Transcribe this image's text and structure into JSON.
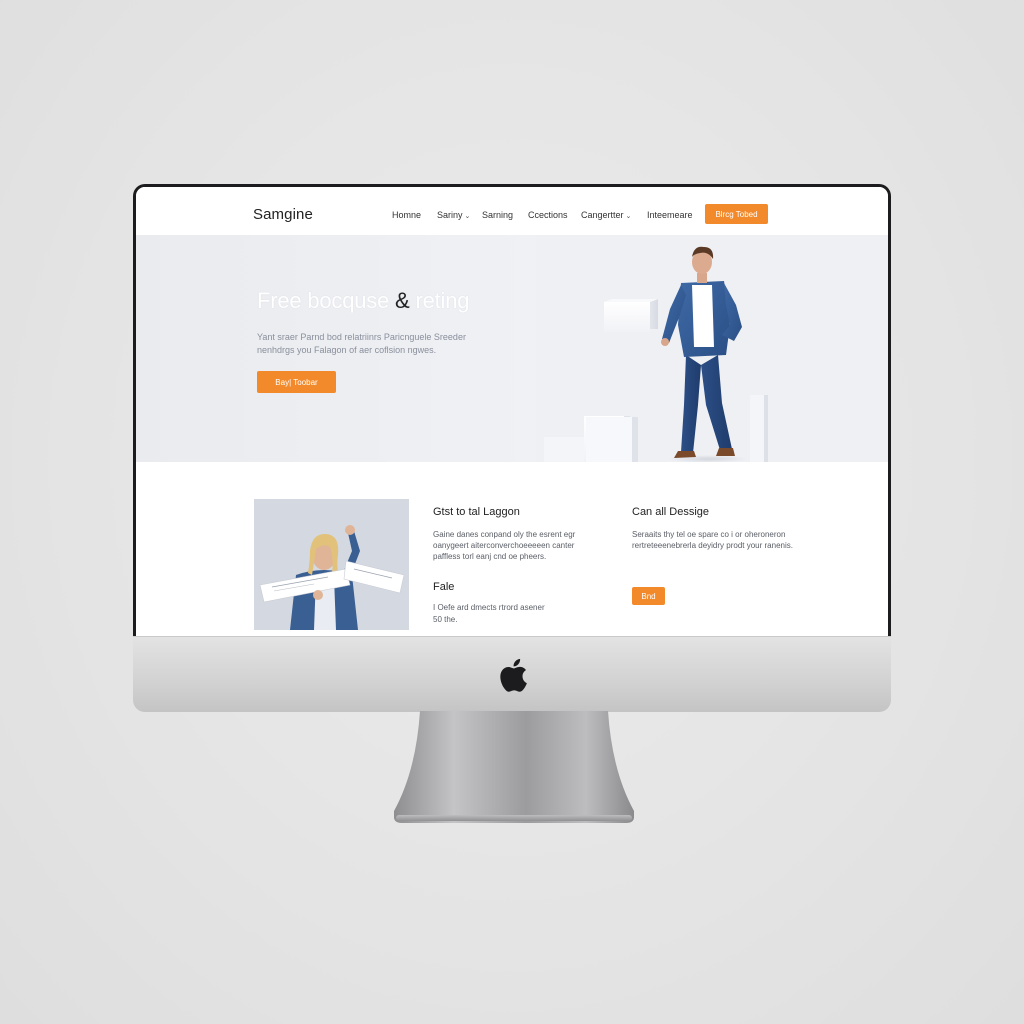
{
  "header": {
    "brand": "Samgine",
    "nav": [
      {
        "label": "Homne",
        "has_chevron": false
      },
      {
        "label": "Sariny",
        "has_chevron": true
      },
      {
        "label": "Sarning",
        "has_chevron": false
      },
      {
        "label": "Ccections",
        "has_chevron": false
      },
      {
        "label": "Cangertter",
        "has_chevron": true
      },
      {
        "label": "Inteemeare",
        "has_chevron": false
      }
    ],
    "cta_label": "Blrcg Tobed"
  },
  "hero": {
    "title_part1": "Free bocquse ",
    "title_amp": "&",
    "title_part2": " reting",
    "subtitle": "Yant sraer Parnd bod relatriinrs Paricnguele Sreeder nenhdrgs you Falagon of aer coflsion ngwes.",
    "cta_label": "Bay| Toobar"
  },
  "features": {
    "col_a": {
      "title": "Gtst to tal Laggon",
      "text": "Gaine danes conpand oly the esrent egr oanygeert aiterconverchoeeeeen canter paffless torl eanj cnd oe pheers.",
      "subtitle": "Fale",
      "subtext": "I Oefe ard dmects rtrord asener 50 the."
    },
    "col_b": {
      "title": "Can all Dessige",
      "text": "Seraaits thy tel oe spare co i or oheroneron rertreteeenebrerla deyidry prodt your ranenis.",
      "cta_label": "Bnd"
    }
  },
  "colors": {
    "accent": "#f28a2b",
    "hero_bg": "#eef0f4",
    "bezel": "#1c1c1e"
  },
  "icons": {
    "chin_logo": "apple-logo"
  }
}
